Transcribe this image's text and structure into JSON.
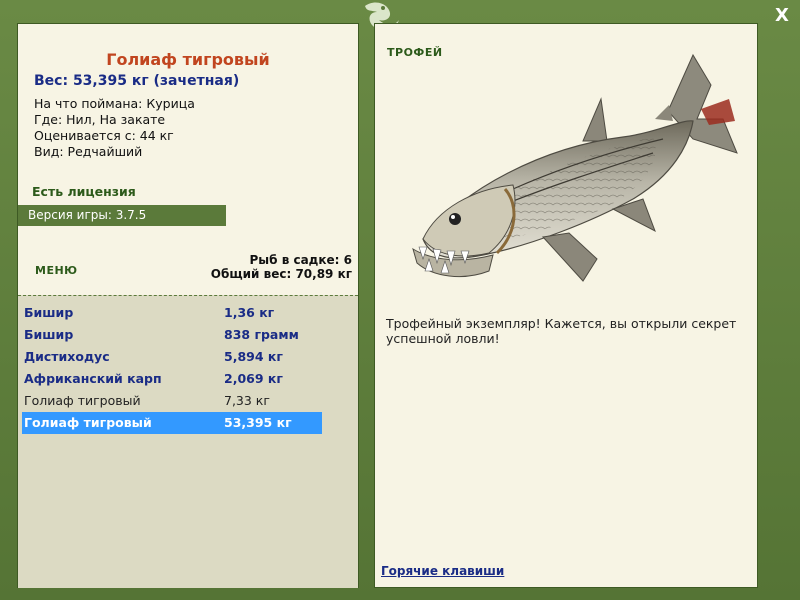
{
  "window": {
    "close_label": "X"
  },
  "fish": {
    "title": "Голиаф тигровый",
    "weight": "Вес: 53,395 кг (зачетная)",
    "details": [
      "На что поймана: Курица",
      "Где: Нил, На закате",
      "Оценивается с: 44 кг",
      "Вид: Редчайший"
    ]
  },
  "license": "Есть лицензия",
  "version": "Версия игры: 3.7.5",
  "menu_label": "МЕНЮ",
  "keepnet": {
    "count": "Рыб в садке: 6",
    "total": "Общий вес: 70,89 кг"
  },
  "catch_list": [
    {
      "name": "Бишир",
      "weight": "1,36 кг",
      "style": "bold"
    },
    {
      "name": "Бишир",
      "weight": "838 грамм",
      "style": "bold"
    },
    {
      "name": "Дистиходус",
      "weight": "5,894 кг",
      "style": "bold"
    },
    {
      "name": "Африканский карп",
      "weight": "2,069 кг",
      "style": "bold"
    },
    {
      "name": "Голиаф тигровый",
      "weight": "7,33 кг",
      "style": "plain"
    },
    {
      "name": "Голиаф тигровый",
      "weight": "53,395 кг",
      "style": "selected"
    }
  ],
  "trophy": {
    "label": "ТРОФЕЙ",
    "text": "Трофейный экземпляр! Кажется, вы открыли секрет успешной ловли!"
  },
  "hotkeys_link": "Горячие клавиши",
  "icons": {
    "close": "close-icon",
    "logo": "lizard-logo-icon",
    "fish": "tiger-fish-image"
  },
  "colors": {
    "frame": "#5b7a3a",
    "panel": "#f7f4e4",
    "title": "#c1451f",
    "link": "#1a2c86",
    "selected": "#3399ff"
  }
}
